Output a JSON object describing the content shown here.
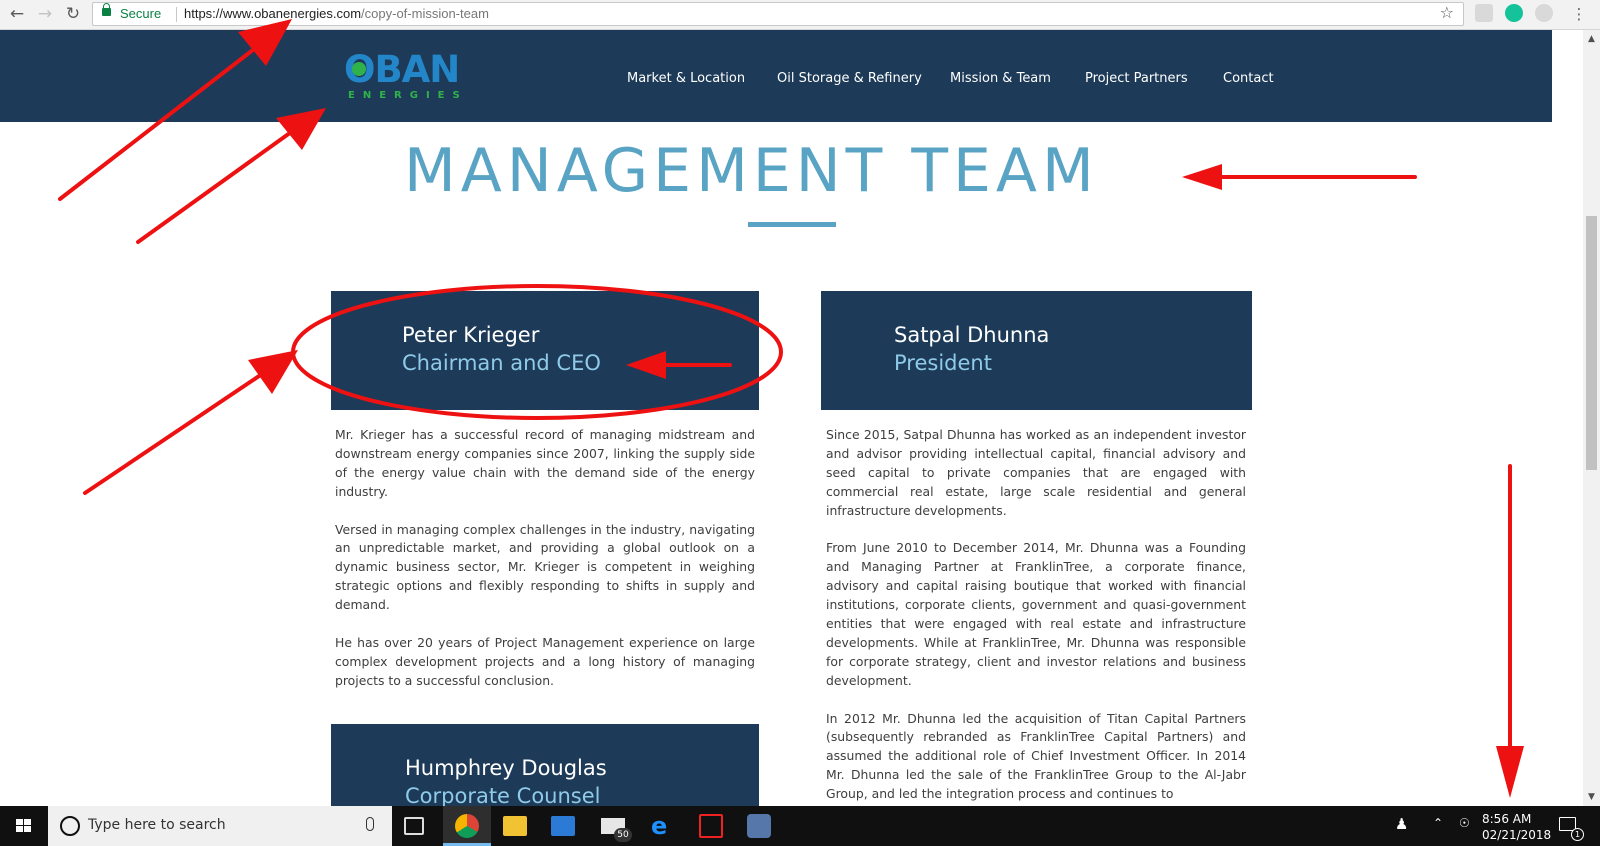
{
  "browser": {
    "secure_label": "Secure",
    "url_host": "https://www.obanenergies.com",
    "url_path": "/copy-of-mission-team"
  },
  "site": {
    "logo_main": "OBAN",
    "logo_sub": "ENERGIES",
    "nav": [
      {
        "label": "Market & Location"
      },
      {
        "label": "Oil Storage & Refinery"
      },
      {
        "label": "Mission & Team"
      },
      {
        "label": "Project Partners"
      },
      {
        "label": "Contact"
      }
    ]
  },
  "page": {
    "title": "MANAGEMENT TEAM",
    "members": [
      {
        "name": "Peter Krieger",
        "role": "Chairman and CEO",
        "bio": [
          "Mr. Krieger has a successful record of managing midstream and downstream energy companies since 2007, linking the supply side of the energy value chain with the demand side of the energy industry.",
          "Versed in managing complex challenges in the industry, navigating an unpredictable market, and providing a global outlook on a dynamic business sector, Mr. Krieger is competent in weighing strategic options and flexibly responding to shifts in supply and demand.",
          "He has over 20 years of Project Management experience on large complex development projects and a long history of managing projects to a successful conclusion."
        ]
      },
      {
        "name": "Satpal Dhunna",
        "role": "President",
        "bio": [
          "Since 2015, Satpal Dhunna has worked as an independent investor and advisor providing intellectual capital, financial advisory and seed capital to private companies that are engaged with commercial real estate, large scale residential and general infrastructure developments.",
          "From June 2010 to December 2014, Mr. Dhunna was a Founding and Managing Partner at FranklinTree, a corporate finance, advisory and capital raising boutique that worked with financial institutions, corporate clients, government and quasi-government entities that were engaged with real estate and infrastructure developments.  While at FranklinTree, Mr. Dhunna was responsible for corporate strategy, client and investor relations and business development.",
          "In 2012 Mr. Dhunna led the acquisition of Titan Capital Partners (subsequently rebranded as FranklinTree Capital Partners) and assumed the additional role of Chief Investment Officer.  In 2014 Mr. Dhunna led the sale of the FranklinTree Group to the Al-Jabr Group, and led the integration process and continues to"
        ]
      },
      {
        "name": "Humphrey Douglas",
        "role": "Corporate Counsel"
      }
    ]
  },
  "taskbar": {
    "search_placeholder": "Type here to search",
    "mail_badge": "50",
    "time": "8:56 AM",
    "date": "02/21/2018",
    "notification_count": "1"
  },
  "colors": {
    "header_bg": "#1d3b58",
    "title": "#59a3c4",
    "role_text": "#8fcbe9",
    "annotation": "#ee1111"
  }
}
